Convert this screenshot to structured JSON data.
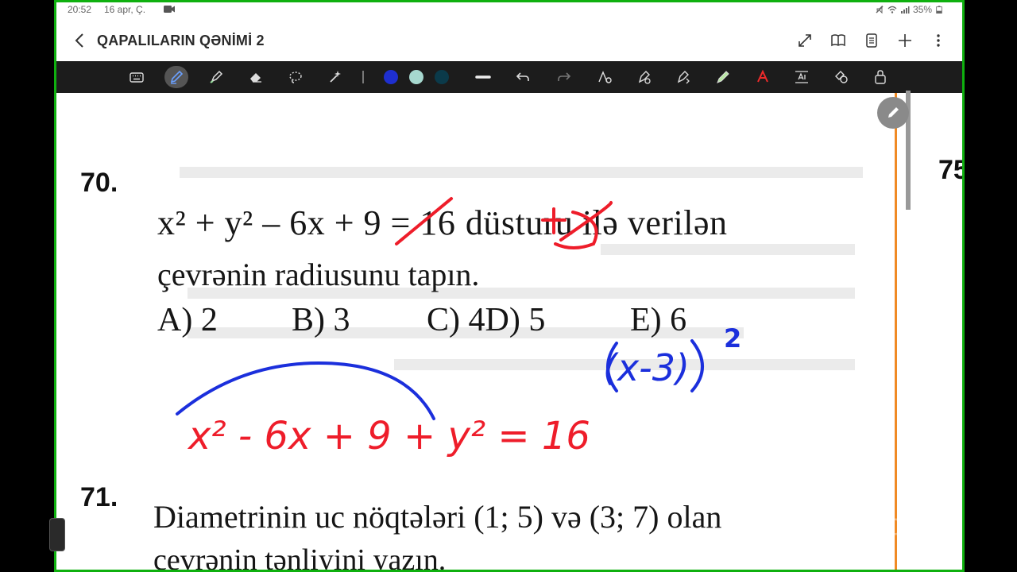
{
  "status": {
    "time": "20:52",
    "date": "16 apr, Ç.",
    "battery": "35%"
  },
  "title": "QAPALILARIN QƏNİMİ 2",
  "colors": {
    "frame": "#0fb00f",
    "toolbar": "#1c1c1c",
    "pen_blue": "#1b2fdc",
    "pen_red": "#ee1d2a",
    "swatch_1": "#1e2fd0",
    "swatch_2": "#a6d8cf",
    "swatch_3": "#0b3a4a",
    "page_edge": "#f08a24"
  },
  "toolbar": {
    "tools": [
      "keyboard-icon",
      "pen-icon",
      "highlighter-icon",
      "eraser-icon",
      "lasso-icon",
      "magic-icon",
      "undo-icon",
      "redo-icon",
      "shape-recognize-icon",
      "fill-icon",
      "format-icon",
      "pencil-color-icon",
      "text-recognize-icon",
      "text-box-icon",
      "shapes-icon",
      "lock-icon"
    ]
  },
  "content": {
    "q70": {
      "number": "70.",
      "line1_part1": "x² + y² – 6x + ",
      "line1_struck": "9",
      "line1_part2": " = 16 ",
      "line1_struck2": "+9",
      "line1_part3": "düsturu ilə verilən",
      "line2": "çevrənin radiusunu tapın.",
      "options": [
        "A) 2",
        "B) 3",
        "C) 4D) 5",
        "E) 6"
      ]
    },
    "q71": {
      "number": "71.",
      "line1": "Diametrinin uc nöqtələri (1; 5) və (3; 7) olan",
      "line2": "çevrənin tənliyini yazın."
    },
    "next_page_number": "75",
    "handwriting": {
      "blue_expression": "(x-3)",
      "blue_exponent": "2",
      "red_equation": "x² - 6x + 9 + y² = 16"
    }
  },
  "watermark": "zoom"
}
